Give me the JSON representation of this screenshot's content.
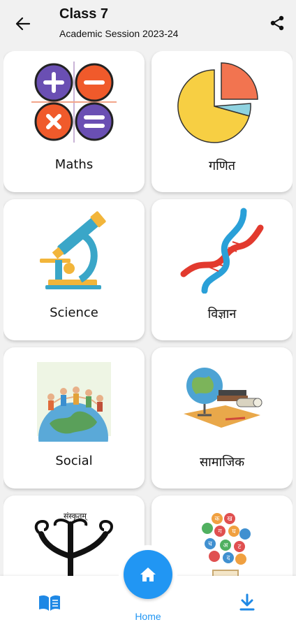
{
  "header": {
    "title": "Class 7",
    "subtitle": "Academic Session 2023-24"
  },
  "subjects": [
    {
      "label": "Maths",
      "icon": "math-operators-icon"
    },
    {
      "label": "गणित",
      "icon": "pie-chart-icon"
    },
    {
      "label": "Science",
      "icon": "microscope-icon"
    },
    {
      "label": "विज्ञान",
      "icon": "dna-icon"
    },
    {
      "label": "Social",
      "icon": "children-on-globe-icon"
    },
    {
      "label": "सामाजिक",
      "icon": "globe-books-map-icon"
    },
    {
      "label": "",
      "icon": "sanskrit-tree-icon",
      "art_text": "संस्कृतम्"
    },
    {
      "label": "",
      "icon": "hindi-letters-icon",
      "art_letters": [
        "क",
        "ख",
        "ग",
        "घ",
        "च",
        "अ",
        "ट",
        "द"
      ]
    }
  ],
  "bottom_nav": {
    "home_label": "Home",
    "left_icon": "book-icon",
    "right_icon": "download-icon"
  },
  "colors": {
    "accent": "#2196f3",
    "background": "#f1f1f1"
  }
}
